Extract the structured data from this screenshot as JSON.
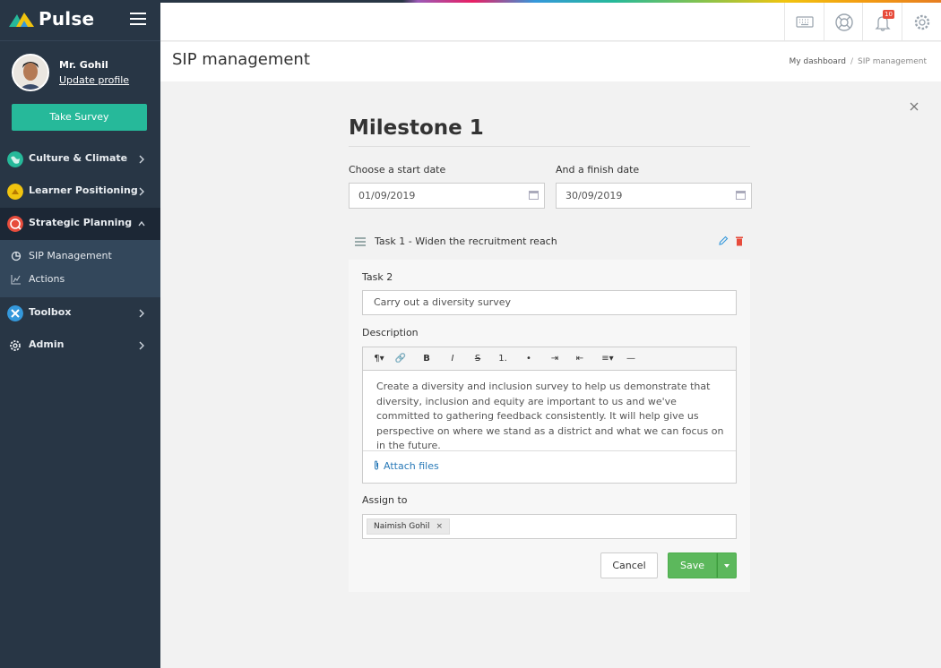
{
  "brand": {
    "name": "Pulse"
  },
  "user": {
    "name": "Mr. Gohil",
    "update_link": "Update profile"
  },
  "sidebar": {
    "survey_button": "Take Survey",
    "items": [
      {
        "label": "Culture & Climate",
        "icon": "globe-icon",
        "color": "#26b99a"
      },
      {
        "label": "Learner Positioning",
        "icon": "learner-icon",
        "color": "#f1c40f"
      },
      {
        "label": "Strategic Planning",
        "icon": "target-icon",
        "color": "#e74c3c"
      },
      {
        "label": "Toolbox",
        "icon": "tools-icon",
        "color": "#3498db"
      },
      {
        "label": "Admin",
        "icon": "gear-icon",
        "color": "#ffffff"
      }
    ],
    "sub_items": [
      {
        "label": "SIP Management",
        "icon": "pie-chart-icon"
      },
      {
        "label": "Actions",
        "icon": "line-chart-icon"
      }
    ]
  },
  "topbar": {
    "notification_count": "10"
  },
  "page": {
    "title": "SIP management",
    "breadcrumb": {
      "home": "My dashboard",
      "separator": "/",
      "current": "SIP management"
    }
  },
  "milestone": {
    "title": "Milestone 1",
    "start_label": "Choose a start date",
    "start_value": "01/09/2019",
    "finish_label": "And a finish date",
    "finish_value": "30/09/2019",
    "task1": {
      "prefix": "Task 1",
      "text": " - Widen the recruitment reach"
    },
    "task2": {
      "label": "Task 2",
      "value": "Carry out a diversity survey",
      "description_label": "Description",
      "toolbar": [
        "¶▾",
        "🔗",
        "B",
        "I",
        "S",
        "1.",
        "•",
        "⇥",
        "⇤",
        "≡▾",
        "—"
      ],
      "description": "Create a diversity and inclusion survey to help us demonstrate that diversity, inclusion and equity are important to us and we've committed to gathering feedback consistently. It will help give us perspective on where we stand as a district and what we can focus on in the future.",
      "attach": "Attach files",
      "assign_label": "Assign to",
      "assignee": "Naimish Gohil"
    },
    "cancel": "Cancel",
    "save": "Save"
  }
}
